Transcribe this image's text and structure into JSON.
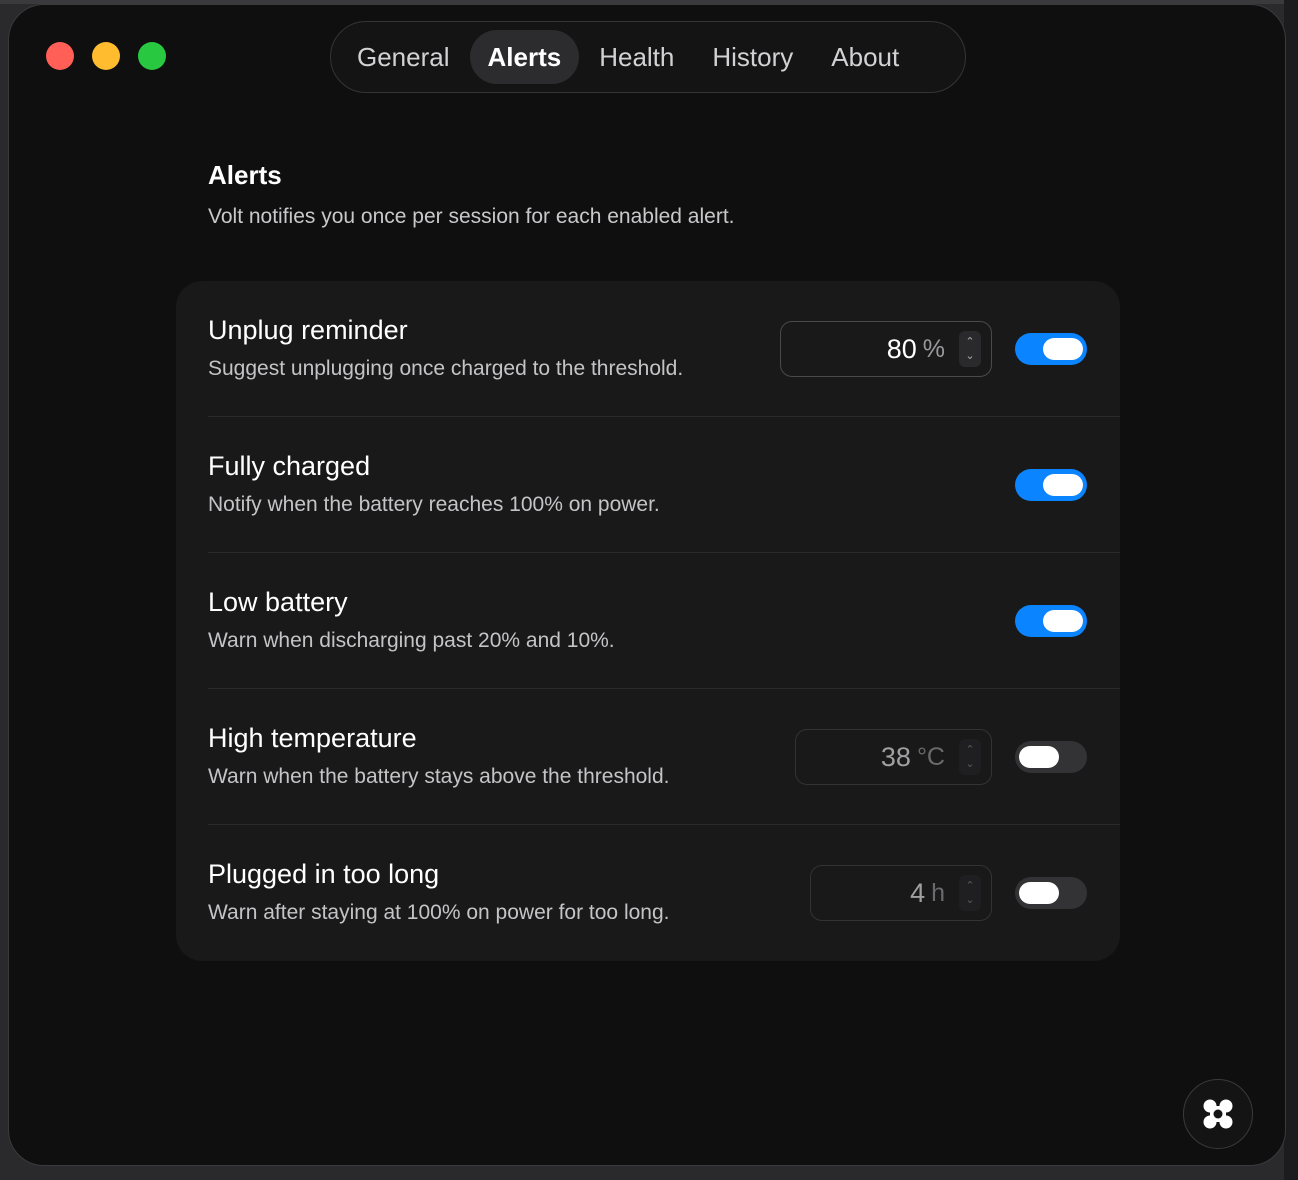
{
  "tabs": [
    {
      "label": "General",
      "active": false
    },
    {
      "label": "Alerts",
      "active": true
    },
    {
      "label": "Health",
      "active": false
    },
    {
      "label": "History",
      "active": false
    },
    {
      "label": "About",
      "active": false
    }
  ],
  "section": {
    "title": "Alerts",
    "subtitle": "Volt notifies you once per session for each enabled alert."
  },
  "alerts": [
    {
      "title": "Unplug reminder",
      "description": "Suggest unplugging once charged to the threshold.",
      "threshold": {
        "value": "80",
        "unit": "%"
      },
      "enabled": true
    },
    {
      "title": "Fully charged",
      "description": "Notify when the battery reaches 100% on power.",
      "enabled": true
    },
    {
      "title": "Low battery",
      "description": "Warn when discharging past 20% and 10%.",
      "enabled": true
    },
    {
      "title": "High temperature",
      "description": "Warn when the battery stays above the threshold.",
      "threshold": {
        "value": "38",
        "unit": "°C"
      },
      "enabled": false
    },
    {
      "title": "Plugged in too long",
      "description": "Warn after staying at 100% on power for too long.",
      "threshold": {
        "value": "4",
        "unit": "h"
      },
      "enabled": false
    }
  ],
  "colors": {
    "accent": "#0a84ff",
    "close": "#ff5f57",
    "minimize": "#febc2e",
    "maximize": "#28c840"
  },
  "icons": {
    "corner_button": "gallery-icon"
  }
}
